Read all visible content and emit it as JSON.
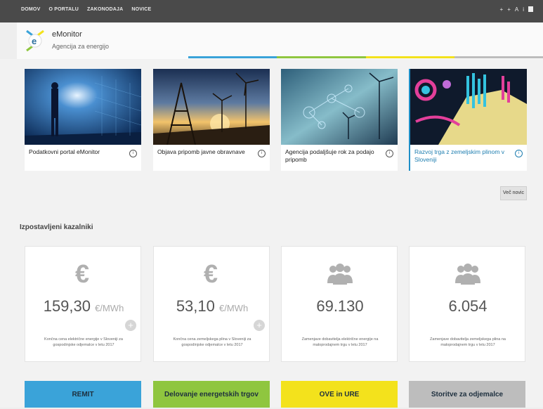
{
  "topnav": {
    "items": [
      "DOMOV",
      "O PORTALU",
      "ZAKONODAJA",
      "NOVICE"
    ]
  },
  "brand": {
    "title": "eMonitor",
    "subtitle": "Agencija za energijo"
  },
  "news": [
    {
      "caption": "Podatkovni portal eMonitor"
    },
    {
      "caption": "Objava pripomb javne obravnave"
    },
    {
      "caption": "Agencija podaljšuje rok za podajo pripomb"
    },
    {
      "caption": "Razvoj trga z zemeljskim plinom v Sloveniji"
    }
  ],
  "more_label": "Več novic",
  "section_title": "Izpostavljeni kazalniki",
  "indicators": [
    {
      "icon": "euro-icon",
      "value": "159,30",
      "unit": "€/MWh",
      "desc": "Končna cena električne energije v Sloveniji za gospodinjske odjemalce v letu 2017"
    },
    {
      "icon": "euro-icon",
      "value": "53,10",
      "unit": "€/MWh",
      "desc": "Končna cena zemeljskega plina v Sloveniji za gospodinjske odjemalce v letu 2017"
    },
    {
      "icon": "users-icon",
      "value": "69.130",
      "unit": "",
      "desc": "Zamenjave dobavitelja električne energije na maloprodajnem trgu v letu 2017"
    },
    {
      "icon": "users-icon",
      "value": "6.054",
      "unit": "",
      "desc": "Zamenjave dobavitelja zemeljskega plina na maloprodajnem trgu v letu 2017"
    }
  ],
  "categories": [
    {
      "label": "REMIT",
      "color": "#3aa3d9"
    },
    {
      "label": "Delovanje energetskih trgov",
      "color": "#8fc63f"
    },
    {
      "label": "OVE in URE",
      "color": "#f3e21c"
    },
    {
      "label": "Storitve za odjemalce",
      "color": "#bdbdbd"
    }
  ],
  "colors": {
    "topbar": "#4a4a4a",
    "accent": "#1e8fc7"
  }
}
